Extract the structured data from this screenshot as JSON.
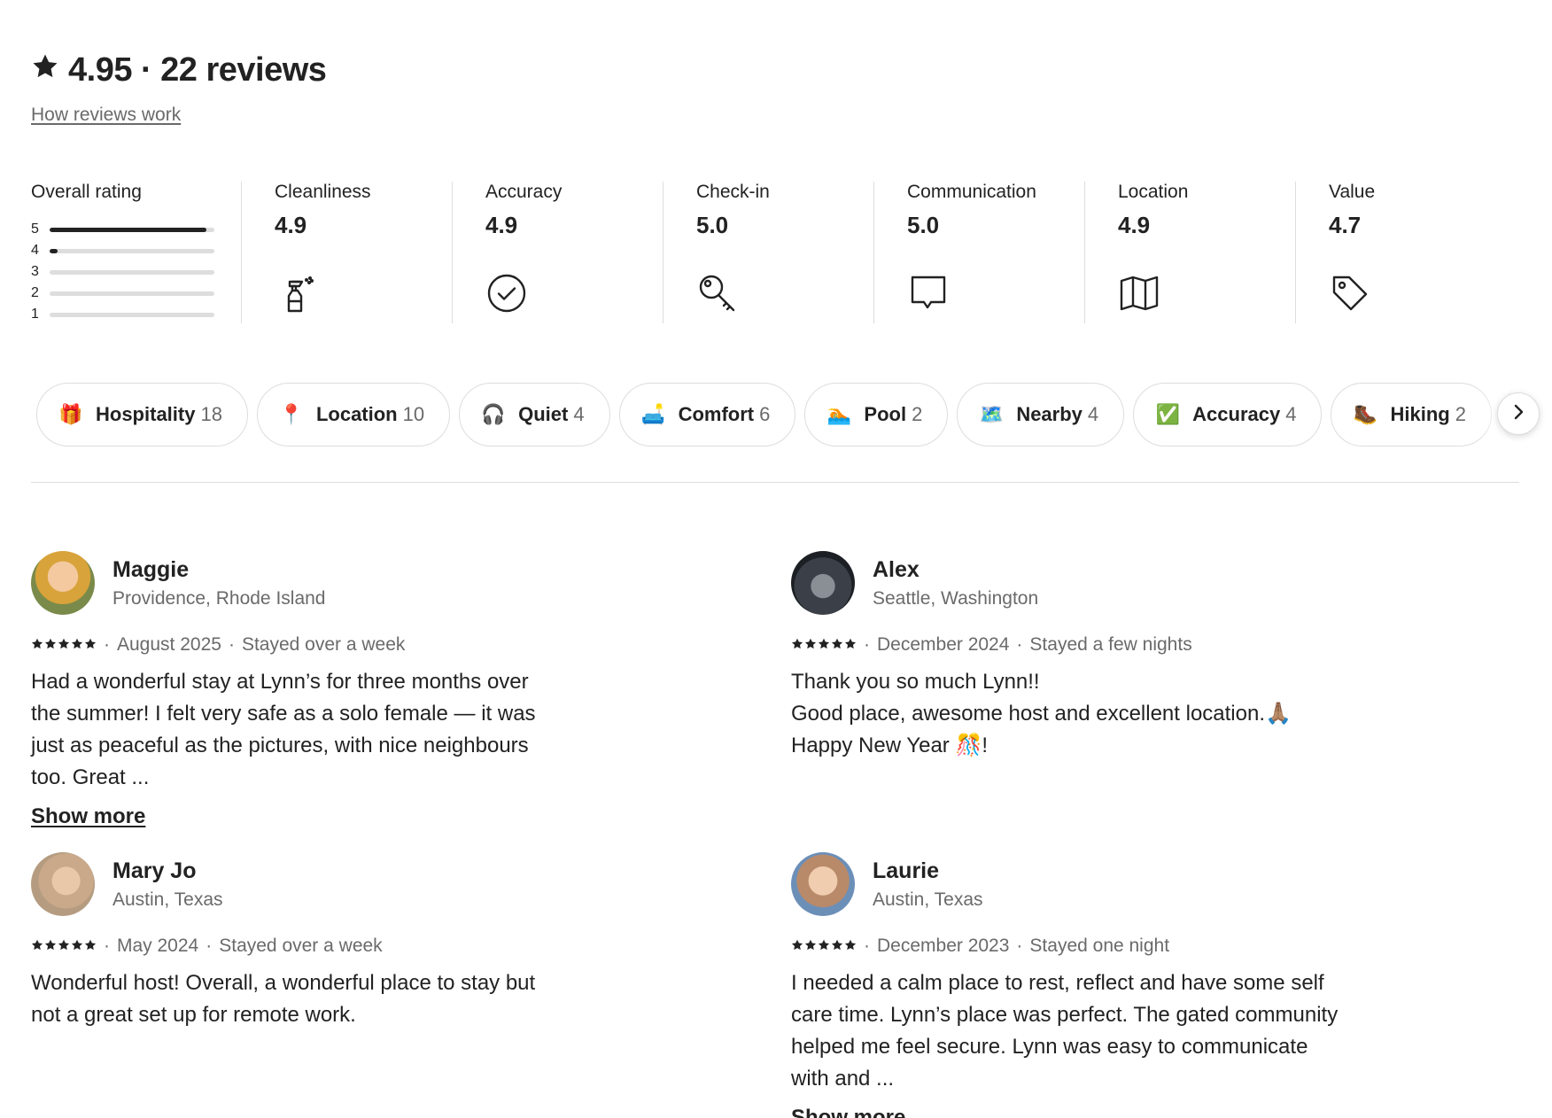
{
  "header": {
    "rating": "4.95",
    "separator": "·",
    "reviews_count": "22 reviews",
    "how_link": "How reviews work"
  },
  "overall": {
    "label": "Overall rating",
    "bars": [
      {
        "star": "5",
        "fraction": 0.95
      },
      {
        "star": "4",
        "fraction": 0.05
      },
      {
        "star": "3",
        "fraction": 0
      },
      {
        "star": "2",
        "fraction": 0
      },
      {
        "star": "1",
        "fraction": 0
      }
    ]
  },
  "categories": [
    {
      "label": "Cleanliness",
      "value": "4.9",
      "icon": "spray-bottle-icon"
    },
    {
      "label": "Accuracy",
      "value": "4.9",
      "icon": "check-circle-icon"
    },
    {
      "label": "Check-in",
      "value": "5.0",
      "icon": "key-icon"
    },
    {
      "label": "Communication",
      "value": "5.0",
      "icon": "chat-bubble-icon"
    },
    {
      "label": "Location",
      "value": "4.9",
      "icon": "map-icon"
    },
    {
      "label": "Value",
      "value": "4.7",
      "icon": "tag-icon"
    }
  ],
  "chips": [
    {
      "emoji": "🎁",
      "label": "Hospitality",
      "count": "18"
    },
    {
      "emoji": "📍",
      "label": "Location",
      "count": "10"
    },
    {
      "emoji": "🎧",
      "label": "Quiet",
      "count": "4"
    },
    {
      "emoji": "🛋️",
      "label": "Comfort",
      "count": "6"
    },
    {
      "emoji": "🏊",
      "label": "Pool",
      "count": "2"
    },
    {
      "emoji": "🗺️",
      "label": "Nearby",
      "count": "4"
    },
    {
      "emoji": "✅",
      "label": "Accuracy",
      "count": "4"
    },
    {
      "emoji": "🥾",
      "label": "Hiking",
      "count": "2"
    },
    {
      "emoji": "🌷",
      "label": "",
      "count": ""
    }
  ],
  "reviews": [
    {
      "name": "Maggie",
      "location": "Providence, Rhode Island",
      "rating": 5,
      "date": "August 2025",
      "stay": "Stayed over a week",
      "text": [
        "Had a wonderful stay at Lynn’s for three months over the summer! I felt very safe as a solo female — it was just as peaceful as the pictures, with nice neighbours too. Great ..."
      ],
      "show_more": "Show more"
    },
    {
      "name": "Alex",
      "location": "Seattle, Washington",
      "rating": 5,
      "date": "December 2024",
      "stay": "Stayed a few nights",
      "text": [
        "Thank you so much Lynn!!",
        "Good place, awesome host and excellent location.🙏🏽",
        "Happy New Year 🎊!"
      ],
      "show_more": ""
    },
    {
      "name": "Mary Jo",
      "location": "Austin, Texas",
      "rating": 5,
      "date": "May 2024",
      "stay": "Stayed over a week",
      "text": [
        "Wonderful host! Overall, a wonderful place to stay but not a great set up for remote work."
      ],
      "show_more": ""
    },
    {
      "name": "Laurie",
      "location": "Austin, Texas",
      "rating": 5,
      "date": "December 2023",
      "stay": "Stayed one night",
      "text": [
        "I needed a calm place to rest, reflect and have some self care time. Lynn’s place was perfect. The gated community helped me feel secure. Lynn was easy to communicate with and ..."
      ],
      "show_more": "Show more"
    }
  ],
  "meta_separator": "·"
}
